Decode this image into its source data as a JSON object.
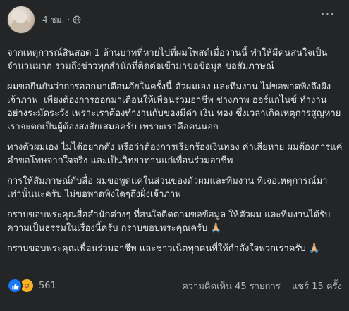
{
  "post": {
    "timestamp": "4 ชม.",
    "more_label": "···",
    "paragraphs": [
      "จากเหตุการณ์สินสอด 1 ล้านบาทที่หายไปที่ผมโพสต์เมื่อวานนี้ ทำให้มีคนสนใจเป็นจำนวนมาก รวมถึงข่าวทุกสำนักที่ติดต่อเข้ามาขอข้อมูล ขอสัมภาษณ์",
      "ผมขอยืนยันว่าการออกมาเตือนภัยในครั้งนี้ ตัวผมเอง และทีมงาน ไม่ขอพาดพิงถึงฝั่งเจ้าภาพ  เพียงต้องการออกมาเตือนให้เพื่อนร่วมอาชีพ ช่างภาพ ออร์แกไนซ์ ทำงานอย่างระมัดระวัง เพราะเราต้องทำงานกับของมีค่า เงิน ทอง ซึ่งเวลาเกิดเหตุการสูญหาย เราจะตกเป็นผู้ต้องสงสัยเสมอครับ เพราะเราคือคนนอก",
      "ทางตัวผมเอง ไม่ได้อยากดัง หรือว่าต้องการเรียกร้องเงินทอง ค่าเสียหาย ผมต้องการแค่คำขอโทษจากใจจริง และเป็นวิทยาทานแก่เพื่อนร่วมอาชีพ",
      "การให้สัมภาษณ์กับสื่อ ผมขอพูดแค่ในส่วนของตัวผมและทีมงาน ที่เจอเหตุการณ์มาเท่านั้นนะครับ ไม่ขอพาดพิงใดๆถึงฝั่งเจ้าภาพ",
      "กราบขอบพระคุณสื่อสำนักต่างๆ ที่สนใจติดตามขอข้อมูล ให้ตัวผม และทีมงานได้รับความเป็นธรรมในเรื่องนี้ครับ กราบขอบพระคุณครับ 🙏🏼",
      "กราบขอบพระคุณเพื่อนร่วมอาชีพ และชาวเน็ตทุกคนที่ให้กำลังใจพวกเราครับ 🙏🏼"
    ]
  },
  "footer": {
    "reaction_count": "561",
    "comments": "ความคิดเห็น 45 รายการ",
    "shares": "แชร์ 15 ครั้ง"
  },
  "colors": {
    "background": "#242526",
    "text": "#e4e6eb",
    "secondary_text": "#b0b3b8",
    "like_blue": "#1877f2",
    "care_yellow": "#f7b125"
  }
}
